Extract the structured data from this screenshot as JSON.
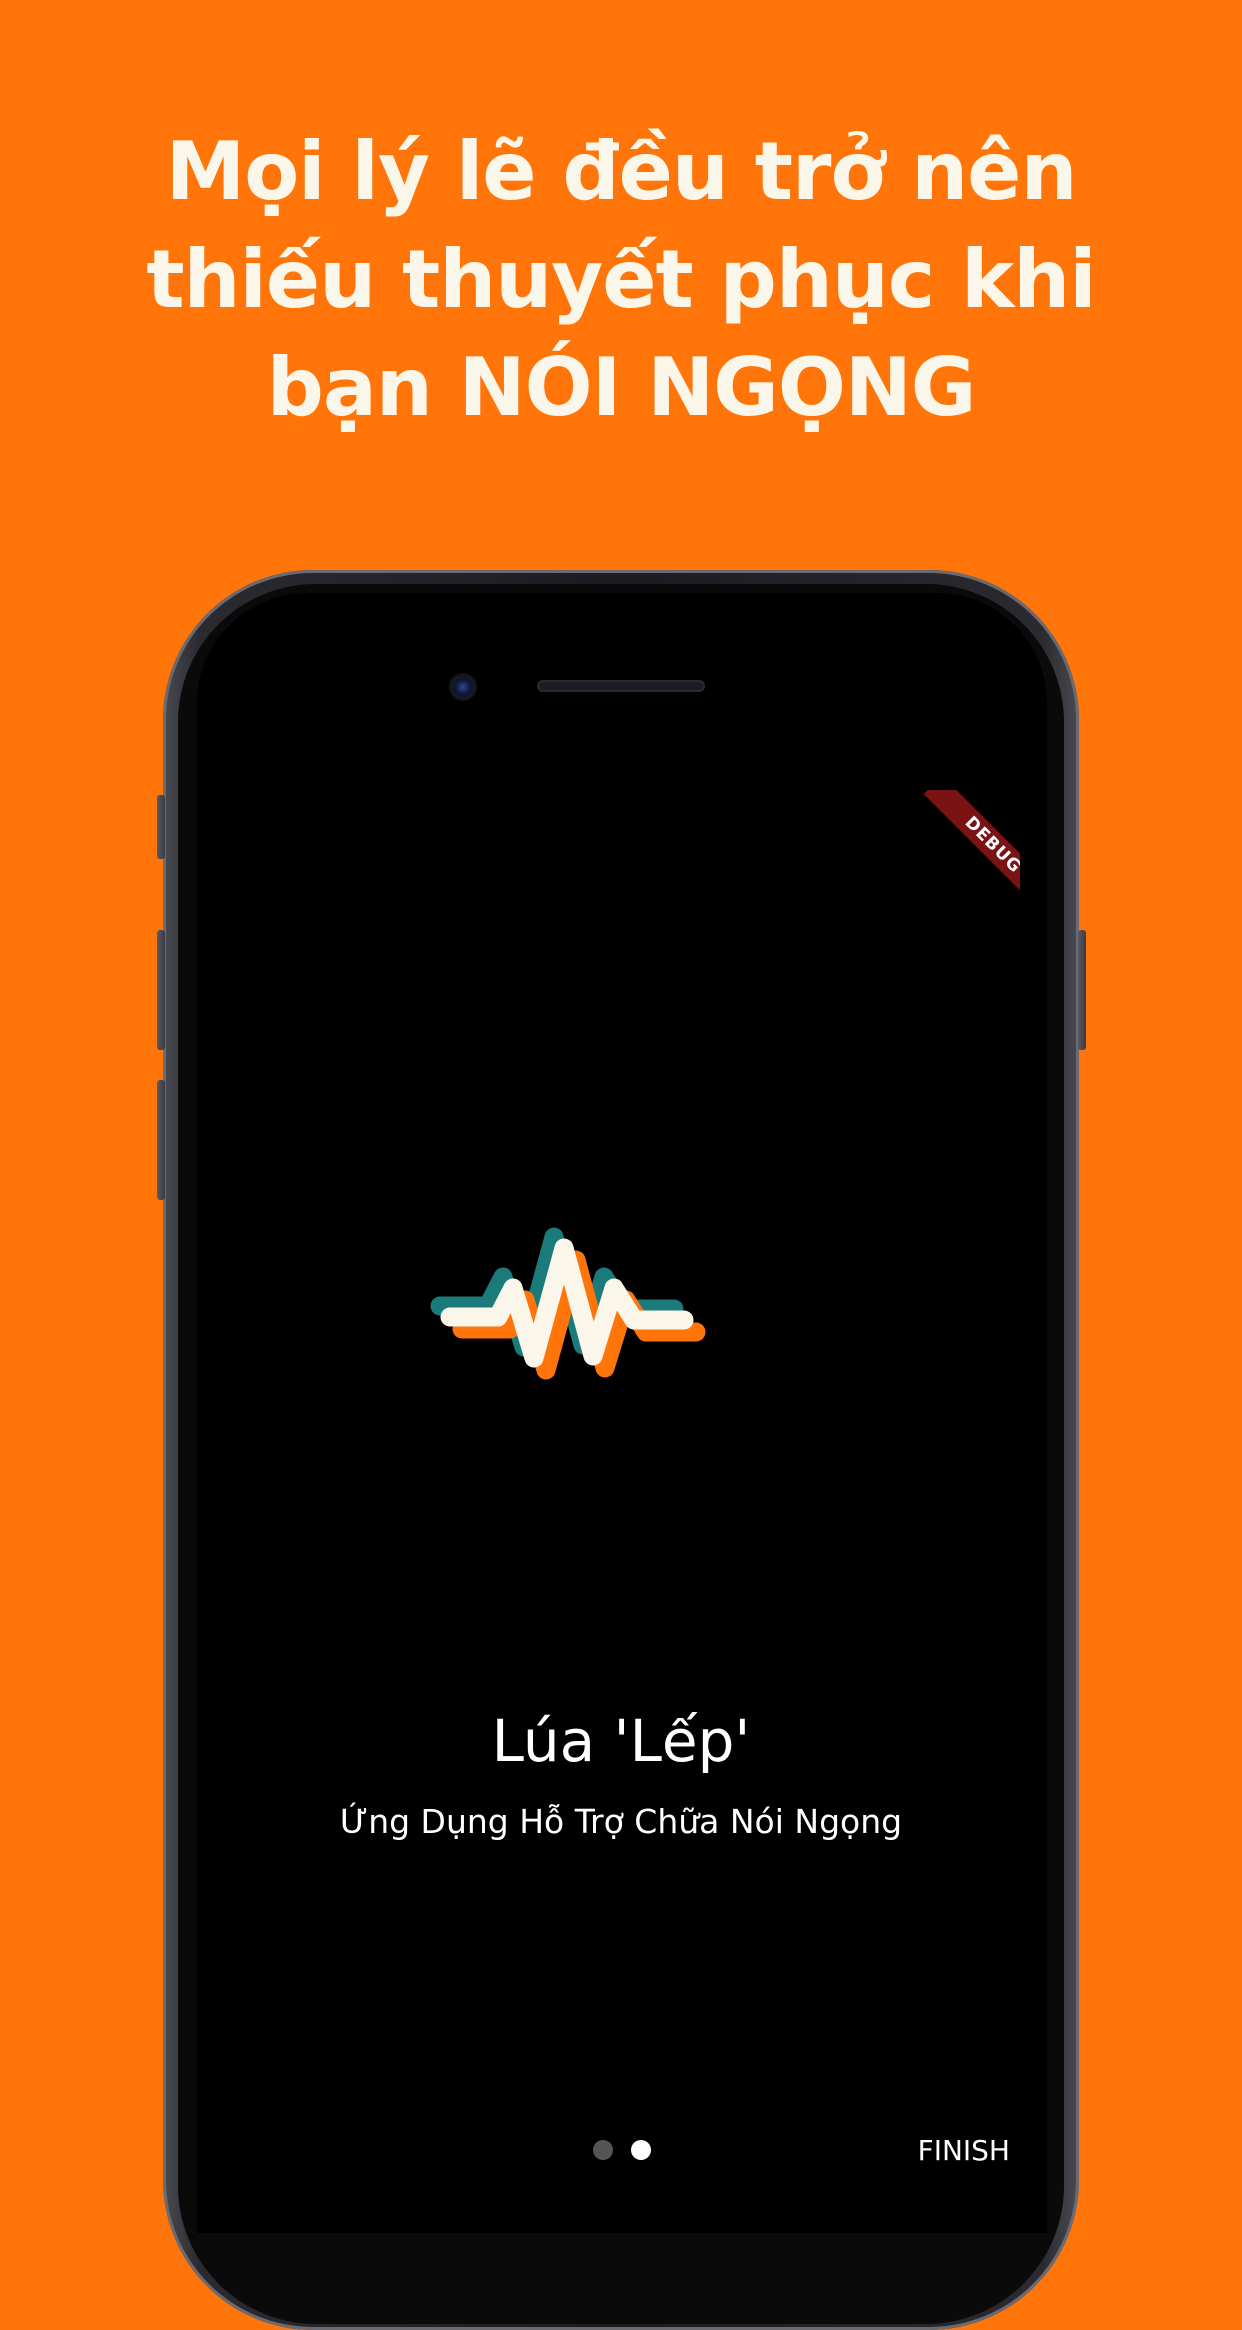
{
  "headline": {
    "line1": "Mọi lý lẽ đều trở nên",
    "line2": "thiếu thuyết phục khi",
    "line3": "bạn NÓI NGỌNG"
  },
  "screen": {
    "debug_banner": "DEBUG",
    "logo_icon": "sound-wave-icon",
    "app_title": "Lúa 'Lếp'",
    "app_subtitle": "Ứng Dụng Hỗ Trợ Chữa Nói Ngọng",
    "pager": {
      "total": 2,
      "current": 2
    },
    "finish_label": "FINISH"
  },
  "colors": {
    "background": "#FF750A",
    "headline_text": "#FBF6EA",
    "screen_bg": "#000000",
    "wave_white": "#FBF6EA",
    "wave_teal": "#1B7A7A",
    "wave_orange": "#FF750A",
    "debug_banner": "#7A1414"
  }
}
